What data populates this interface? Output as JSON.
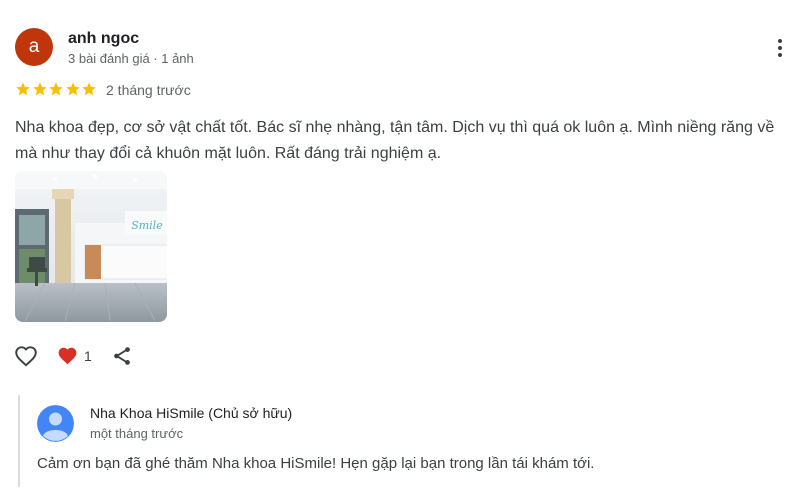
{
  "review": {
    "author": {
      "avatar_letter": "a",
      "avatar_color": "#bf360c",
      "name": "anh ngoc",
      "meta": "3 bài đánh giá · 1 ảnh"
    },
    "menu_icon": "more-vert-icon",
    "rating": 5,
    "star_color": "#fbbc04",
    "time_ago": "2 tháng trước",
    "text": "Nha khoa đẹp, cơ sở vật chất tốt. Bác sĩ nhẹ nhàng, tận tâm. Dịch vụ thì quá ok luôn ạ. Mình niềng răng về mà như thay đổi cả khuôn mặt luôn. Rất đáng trải nghiệm ạ.",
    "photo_count": 1,
    "actions": {
      "like_icon": "heart-outline-icon",
      "reaction_icon": "heart-filled-icon",
      "reaction_color": "#d93025",
      "reaction_count": "1",
      "share_icon": "share-icon"
    }
  },
  "owner_reply": {
    "avatar_icon": "person-icon",
    "avatar_color": "#4285f4",
    "name": "Nha Khoa HiSmile (Chủ sở hữu)",
    "time_ago": "một tháng trước",
    "text": "Cảm ơn bạn đã ghé thăm Nha khoa HiSmile! Hẹn gặp lại bạn trong lần tái khám tới."
  }
}
